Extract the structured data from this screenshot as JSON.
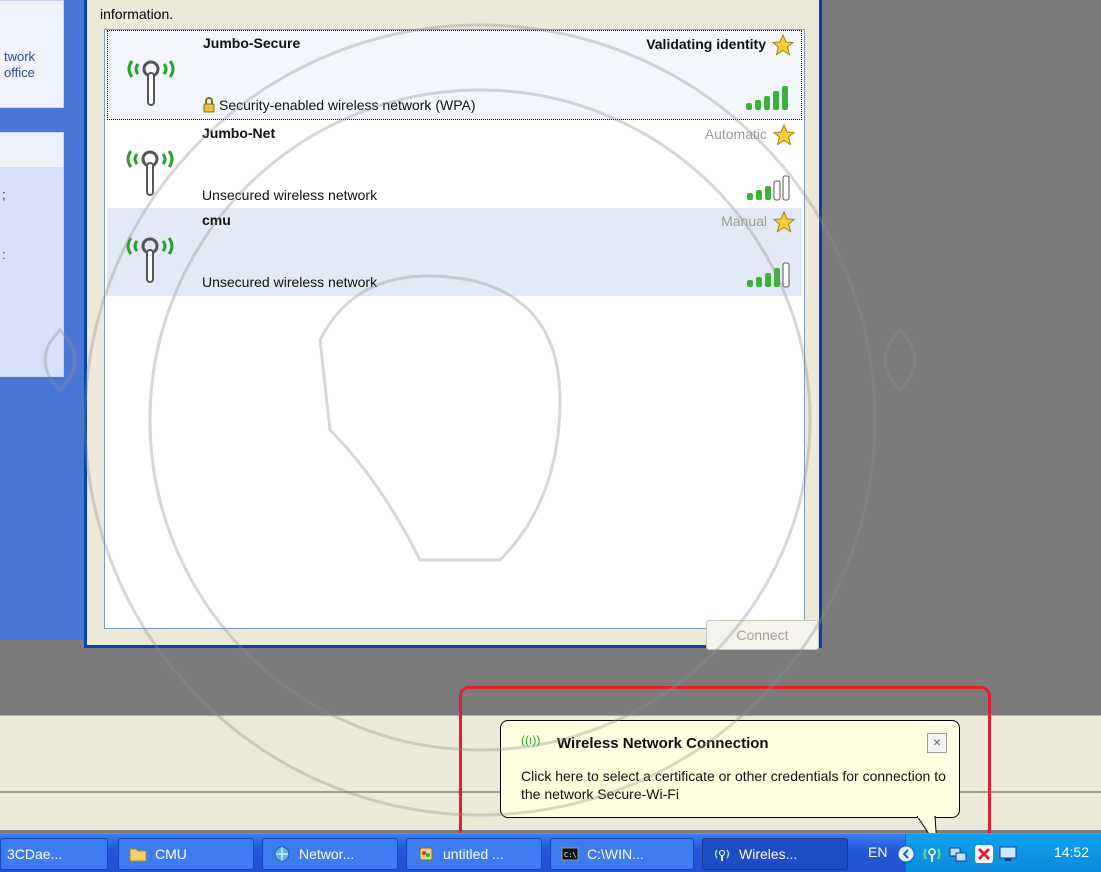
{
  "dialog": {
    "info_text": "information.",
    "networks": [
      {
        "name": "Jumbo-Secure",
        "status": "Validating identity",
        "description": "Security-enabled wireless network (WPA)",
        "secured": true,
        "signal_bars": 5
      },
      {
        "name": "Jumbo-Net",
        "status": "Automatic",
        "description": "Unsecured wireless network",
        "secured": false,
        "signal_bars": 3
      },
      {
        "name": "cmu",
        "status": "Manual",
        "description": "Unsecured wireless network",
        "secured": false,
        "signal_bars": 4
      }
    ],
    "connect_label": "Connect"
  },
  "left_window": {
    "line1": "twork",
    "line2": "office",
    "tick1": ";",
    "tick2": ":"
  },
  "balloon": {
    "icon": "((ı))",
    "title": "Wireless Network Connection",
    "close_label": "×",
    "message": "Click here to select a certificate or other credentials for connection to the network Secure-Wi-Fi"
  },
  "taskbar": {
    "items": [
      {
        "label": "3CDae...",
        "icon": "app-icon"
      },
      {
        "label": "CMU",
        "icon": "folder-icon"
      },
      {
        "label": "Networ...",
        "icon": "network-icon"
      },
      {
        "label": "untitled ...",
        "icon": "paint-icon"
      },
      {
        "label": "C:\\WIN...",
        "icon": "cmd-icon"
      },
      {
        "label": "Wireles...",
        "icon": "wireless-icon"
      }
    ],
    "language": "EN",
    "clock": "14:52"
  },
  "colors": {
    "accent": "#0a3fb6",
    "taskbar": "#245edb",
    "highlight": "#e0202c",
    "balloon_bg": "#ffffe1"
  }
}
